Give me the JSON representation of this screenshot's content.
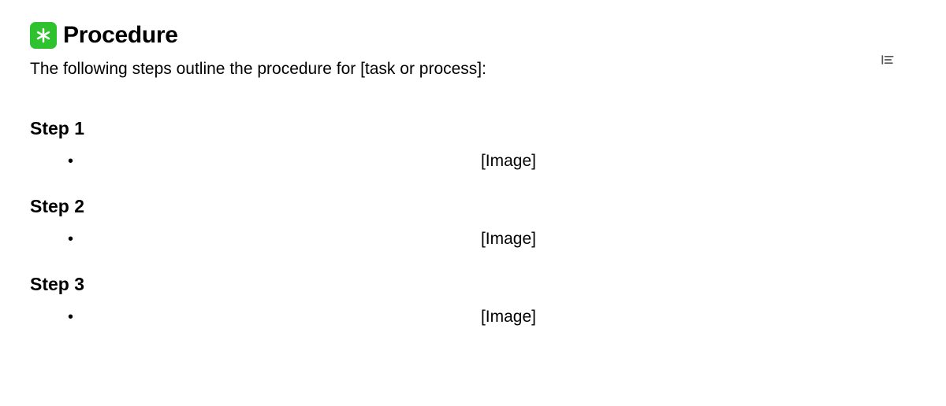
{
  "header": {
    "icon_name": "asterisk-square-icon",
    "title": "Procedure"
  },
  "intro": "The following steps outline the procedure for [task or process]:",
  "steps": [
    {
      "heading": "Step 1",
      "image_placeholder": "[Image]"
    },
    {
      "heading": "Step 2",
      "image_placeholder": "[Image]"
    },
    {
      "heading": "Step 3",
      "image_placeholder": "[Image]"
    }
  ],
  "outline_button_name": "outline-toggle-icon"
}
